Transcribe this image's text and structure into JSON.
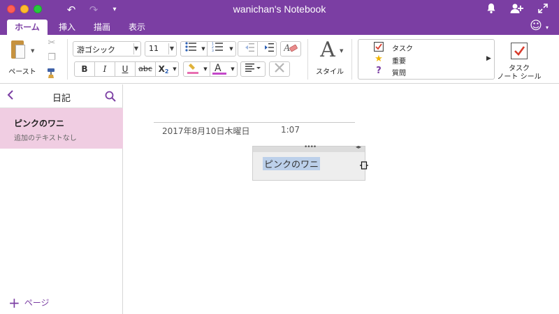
{
  "window": {
    "title": "wanichan's Notebook"
  },
  "tabs": [
    {
      "label": "ホーム",
      "active": true
    },
    {
      "label": "挿入"
    },
    {
      "label": "描画"
    },
    {
      "label": "表示"
    }
  ],
  "ribbon": {
    "paste_label": "ペースト",
    "font_name": "游ゴシック",
    "font_size": "11",
    "bold": "B",
    "italic": "I",
    "underline": "U",
    "strike": "abc",
    "subscript": "X",
    "subscript_mark": "2",
    "font_color_glyph": "A",
    "style_glyph": "A",
    "style_label": "スタイル",
    "tags": [
      {
        "icon": "checkbox-icon",
        "label": "タスク"
      },
      {
        "icon": "star-icon",
        "label": "重要"
      },
      {
        "icon": "question-icon",
        "label": "質問"
      }
    ],
    "todo_label_line1": "タスク",
    "todo_label_line2": "ノート シール"
  },
  "sidebar": {
    "title": "日記",
    "pages": [
      {
        "title": "ピンクのワニ",
        "subtitle": "追加のテキストなし"
      }
    ],
    "add_page_label": "ページ"
  },
  "note": {
    "date": "2017年8月10日木曜日",
    "time": "1:07",
    "text": "ピンクのワニ"
  },
  "colors": {
    "accent": "#7b3ea3",
    "selected_page": "#f0cde2",
    "highlight": "#e86fb1",
    "font_color": "#c447c9",
    "text_selection": "#bcd0ea",
    "todo_check": "#d83b2c"
  }
}
